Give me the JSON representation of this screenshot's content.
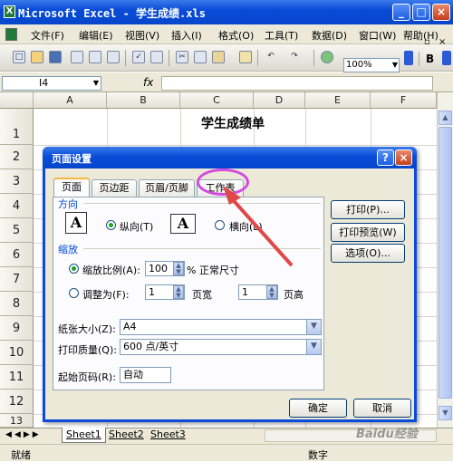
{
  "window": {
    "title": "Microsoft Excel - 学生成绩.xls"
  },
  "menu": [
    "文件(F)",
    "编辑(E)",
    "视图(V)",
    "插入(I)",
    "格式(O)",
    "工具(T)",
    "数据(D)",
    "窗口(W)",
    "帮助(H)"
  ],
  "toolbar": {
    "zoom": "100%",
    "bold": "B"
  },
  "formula": {
    "name_box": "I4",
    "fx": "fx"
  },
  "columns": [
    "A",
    "B",
    "C",
    "D",
    "E",
    "F"
  ],
  "rows": [
    "1",
    "2",
    "3",
    "4",
    "5",
    "6",
    "7",
    "8",
    "9",
    "10",
    "11",
    "12",
    "13"
  ],
  "sheet": {
    "title": "学生成绩单"
  },
  "sheet_tabs": [
    "Sheet1",
    "Sheet2",
    "Sheet3"
  ],
  "status": {
    "left": "就绪",
    "right": "数字"
  },
  "dialog": {
    "title": "页面设置",
    "help": "?",
    "close": "×",
    "tabs": [
      "页面",
      "页边距",
      "页眉/页脚",
      "工作表"
    ],
    "orientation_group": "方向",
    "portrait": "纵向(T)",
    "landscape": "横向(L)",
    "scaling_group": "缩放",
    "scale_label": "缩放比例(A):",
    "scale_value": "100",
    "scale_suffix": "% 正常尺寸",
    "fit_label": "调整为(F):",
    "fit_wide": "1",
    "fit_wide_unit": "页宽",
    "fit_tall": "1",
    "fit_tall_unit": "页高",
    "paper_label": "纸张大小(Z):",
    "paper_value": "A4",
    "quality_label": "打印质量(Q):",
    "quality_value": "600 点/英寸",
    "first_page_label": "起始页码(R):",
    "first_page_value": "自动",
    "btn_print": "打印(P)...",
    "btn_preview": "打印预览(W)",
    "btn_options": "选项(O)...",
    "btn_ok": "确定",
    "btn_cancel": "取消"
  },
  "watermark": "Baidu经验"
}
